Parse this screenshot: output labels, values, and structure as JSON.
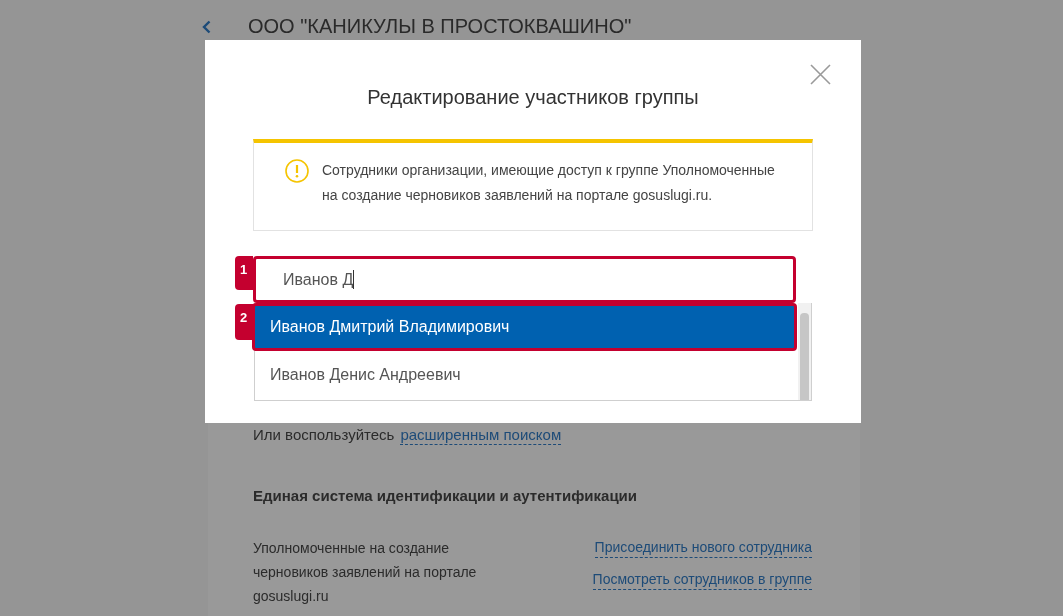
{
  "page": {
    "title": "ООО \"КАНИКУЛЫ В ПРОСТОКВАШИНО\"",
    "search_hint": {
      "text": "Или воспользуйтесь",
      "link": "расширенным поиском"
    },
    "section": {
      "heading": "Единая система идентификации и аутентификации",
      "group": {
        "name": "Уполномоченные на создание черновиков заявлений на портале gosuslugi.ru",
        "links": [
          "Присоединить нового сотрудника",
          "Посмотреть сотрудников в группе"
        ]
      }
    }
  },
  "dialog": {
    "title": "Редактирование участников группы",
    "notice": "Сотрудники организации, имеющие доступ к группе Уполномоченные на создание черновиков заявлений на портале gosuslugi.ru.",
    "search": {
      "value": "Иванов Д",
      "callout": "1"
    },
    "suggestions": [
      {
        "label": "Иванов Дмитрий Владимирович",
        "selected": true,
        "callout": "2"
      },
      {
        "label": "Иванов Денис Андреевич",
        "selected": false
      }
    ]
  }
}
